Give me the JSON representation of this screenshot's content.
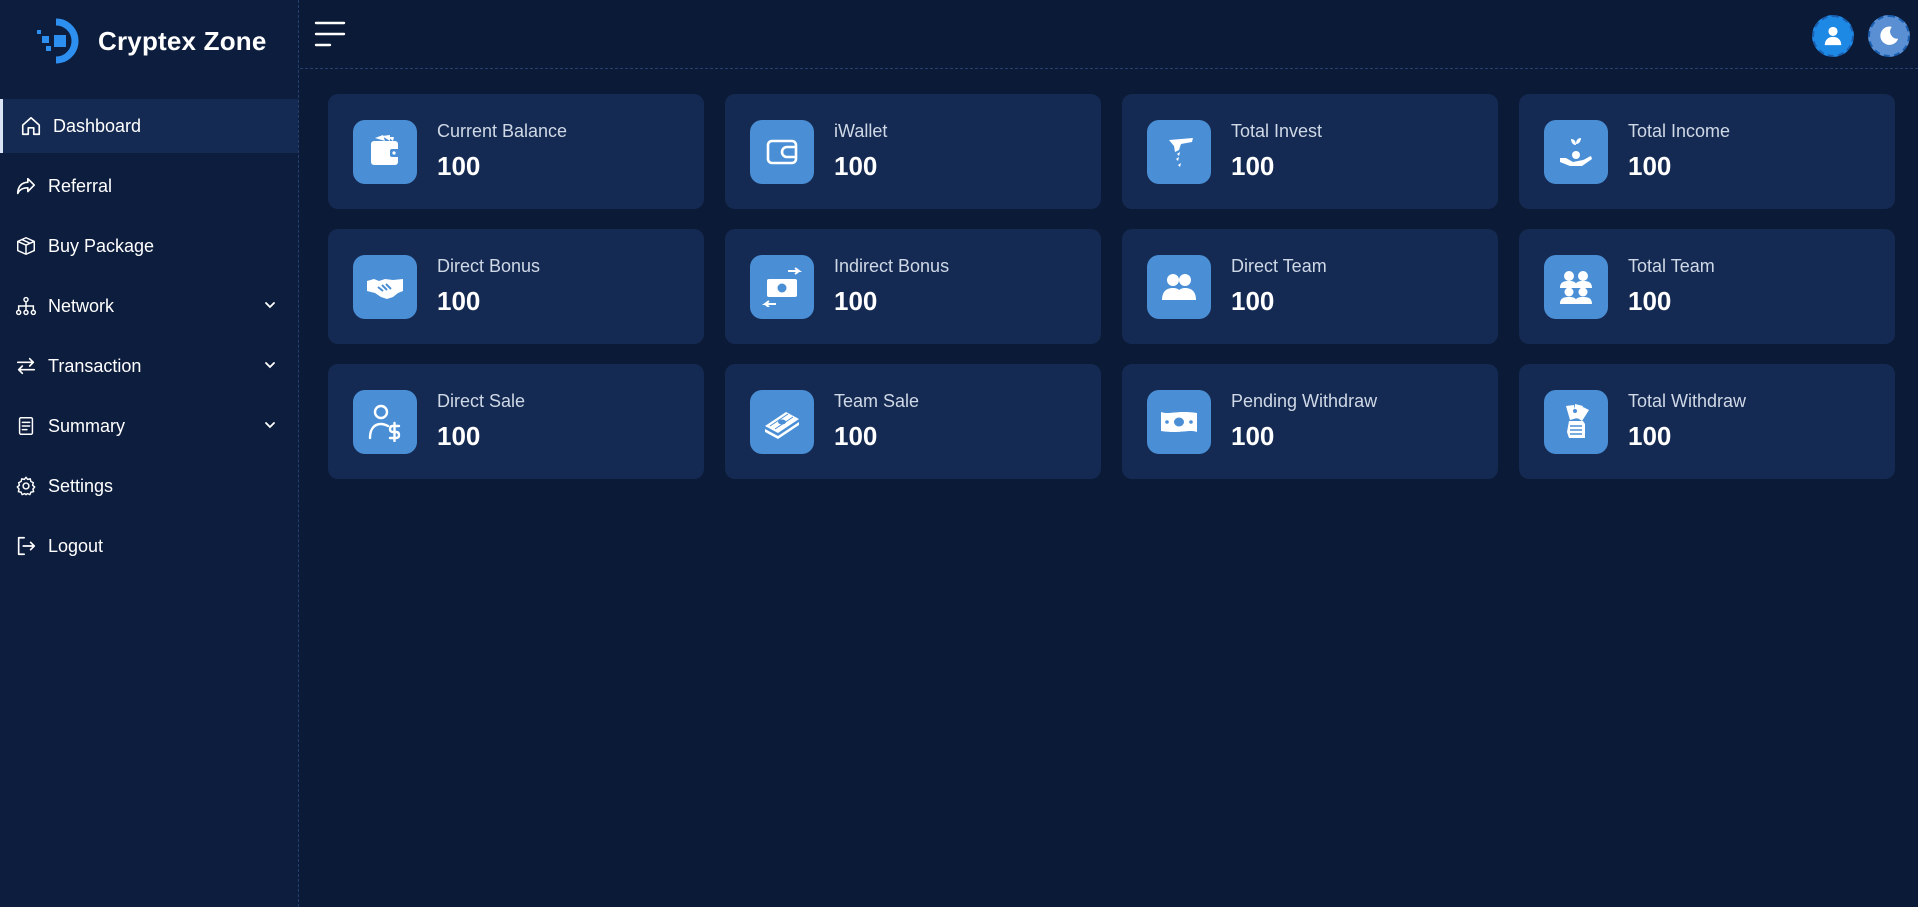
{
  "brand": {
    "name": "Cryptex Zone",
    "logo_icon": "cryptex-logo-icon"
  },
  "topbar": {
    "menu_icon": "hamburger-icon",
    "user_icon": "user-icon",
    "theme_icon": "moon-icon"
  },
  "sidebar": {
    "items": [
      {
        "label": "Dashboard",
        "icon": "home-icon",
        "active": true
      },
      {
        "label": "Referral",
        "icon": "share-arrow-icon"
      },
      {
        "label": "Buy Package",
        "icon": "box-icon"
      },
      {
        "label": "Network",
        "icon": "network-icon",
        "expandable": true
      },
      {
        "label": "Transaction",
        "icon": "transfer-icon",
        "expandable": true
      },
      {
        "label": "Summary",
        "icon": "document-icon",
        "expandable": true
      },
      {
        "label": "Settings",
        "icon": "gear-icon"
      },
      {
        "label": "Logout",
        "icon": "logout-icon"
      }
    ]
  },
  "cards": [
    {
      "label": "Current Balance",
      "value": "100",
      "icon": "wallet-icon"
    },
    {
      "label": "iWallet",
      "value": "100",
      "icon": "card-wallet-icon"
    },
    {
      "label": "Total Invest",
      "value": "100",
      "icon": "invest-hand-icon"
    },
    {
      "label": "Total Income",
      "value": "100",
      "icon": "income-plant-icon"
    },
    {
      "label": "Direct Bonus",
      "value": "100",
      "icon": "handshake-icon"
    },
    {
      "label": "Indirect Bonus",
      "value": "100",
      "icon": "money-exchange-icon"
    },
    {
      "label": "Direct Team",
      "value": "100",
      "icon": "team-pair-icon"
    },
    {
      "label": "Total Team",
      "value": "100",
      "icon": "team-group-icon"
    },
    {
      "label": "Direct Sale",
      "value": "100",
      "icon": "user-dollar-icon"
    },
    {
      "label": "Team Sale",
      "value": "100",
      "icon": "cash-stack-icon"
    },
    {
      "label": "Pending Withdraw",
      "value": "100",
      "icon": "banknote-icon"
    },
    {
      "label": "Total Withdraw",
      "value": "100",
      "icon": "money-hand-icon"
    }
  ],
  "colors": {
    "background": "#0b1a36",
    "sidebar": "#0d1d3e",
    "card": "#152a52",
    "icon_tile": "#4a8fd6",
    "accent": "#1e88e5"
  }
}
